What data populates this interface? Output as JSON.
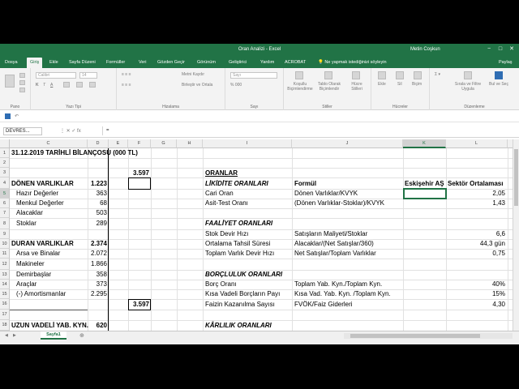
{
  "window": {
    "title": "Oran Analizi  -  Excel",
    "user": "Metin Coşkun",
    "controls": [
      "−",
      "□",
      "✕"
    ]
  },
  "tabs": [
    {
      "label": "Dosya"
    },
    {
      "label": "Giriş"
    },
    {
      "label": "Ekle"
    },
    {
      "label": "Sayfa Düzeni"
    },
    {
      "label": "Formüller"
    },
    {
      "label": "Veri"
    },
    {
      "label": "Gözden Geçir"
    },
    {
      "label": "Görünüm"
    },
    {
      "label": "Geliştirici"
    },
    {
      "label": "Yardım"
    },
    {
      "label": "ACROBAT"
    }
  ],
  "tell_me": "Ne yapmak istediğinizi söyleyin",
  "share": "Paylaş",
  "ribbon": {
    "font_name": "Calibri",
    "font_size": "14",
    "wrap_text": "Metni Kaydır",
    "merge_center": "Birleştir ve Ortala",
    "number_format": "Sayı",
    "cond_format": "Koşullu Biçimlendirme",
    "format_table": "Tablo Olarak Biçimlendir",
    "cell_styles": "Hücre Stilleri",
    "insert": "Ekle",
    "delete": "Sil",
    "format": "Biçim",
    "sort_filter": "Sırala ve Filtre Uygula",
    "find_select": "Bul ve Seç",
    "groups": [
      "Pano",
      "Yazı Tipi",
      "Hizalama",
      "Sayı",
      "Stiller",
      "Hücreler",
      "Düzenleme"
    ]
  },
  "formula_bar": {
    "name_box": "DEVRES...",
    "icons": "⋮   ✕   ✓   fx",
    "value": "="
  },
  "columns": [
    "C",
    "D",
    "E",
    "F",
    "G",
    "H",
    "I",
    "J",
    "K",
    "L"
  ],
  "rows": [
    "1",
    "2",
    "3",
    "4",
    "5",
    "6",
    "7",
    "8",
    "9",
    "10",
    "11",
    "12",
    "13",
    "14",
    "15",
    "16",
    "17",
    "18"
  ],
  "cells": {
    "c1": "31.12.2019 TARİHLİ BİLANÇOSU (000 TL)",
    "f3": "3.597",
    "c4": "DÖNEN VARLIKLAR",
    "d4": "1.223",
    "c5": "Hazır Değerler",
    "d5": "363",
    "c6": "Menkul Değerler",
    "d6": "68",
    "c7": "Alacaklar",
    "d7": "503",
    "c8": "Stoklar",
    "d8": "289",
    "c10": "DURAN VARLIKLAR",
    "d10": "2.374",
    "c11": "Arsa ve Binalar",
    "d11": "2.072",
    "c12": "Makineler",
    "d12": "1.866",
    "c13": "Demirbaşlar",
    "d13": "358",
    "c14": "Araçlar",
    "d14": "373",
    "c15": "(-) Amortismanlar",
    "d15": "2.295",
    "f17": "3.597",
    "c18": "UZUN VADELİ YAB. KYN.",
    "d18": "620",
    "i3": "ORANLAR",
    "i4": "LİKİDİTE ORANLARI",
    "j4": "Formül",
    "k4": "Eskişehir AŞ",
    "l4": "Sektör Ortalaması",
    "i5": "Cari Oran",
    "j5": "Dönen Varlıklar/KVYK",
    "l5": "2,05",
    "i6": "Asit-Test Oranı",
    "j6": "(Dönen Varlıklar-Stoklar)/KVYK",
    "l6": "1,43",
    "i8": "FAALİYET ORANLARI",
    "i9": "Stok Devir Hızı",
    "j9": "Satışların Maliyeti/Stoklar",
    "l9": "6,6",
    "i10": "Ortalama Tahsil Süresi",
    "j10": "Alacaklar/(Net Satışlar/360)",
    "l10": "44,3 gün",
    "i11": "Toplam Varlık Devir Hızı",
    "j11": "Net Satışlar/Toplam Varlıklar",
    "l11": "0,75",
    "i13": "BORÇLULUK ORANLARI",
    "i14": "Borç Oranı",
    "j14": "Toplam Yab. Kyn./Toplam Kyn.",
    "l14": "40%",
    "i15": "Kısa Vadeli Borçların Payı",
    "j15": "Kısa Vad. Yab. Kyn. /Toplam Kyn.",
    "l15": "15%",
    "i16": "Faizin Kazanılma Sayısı",
    "j16": "FVÖK/Faiz Giderleri",
    "l16": "4,30",
    "i18": "KÂRLILIK ORANLARI"
  },
  "sheet_tab": "Sayfa1",
  "add_sheet": "⊕"
}
